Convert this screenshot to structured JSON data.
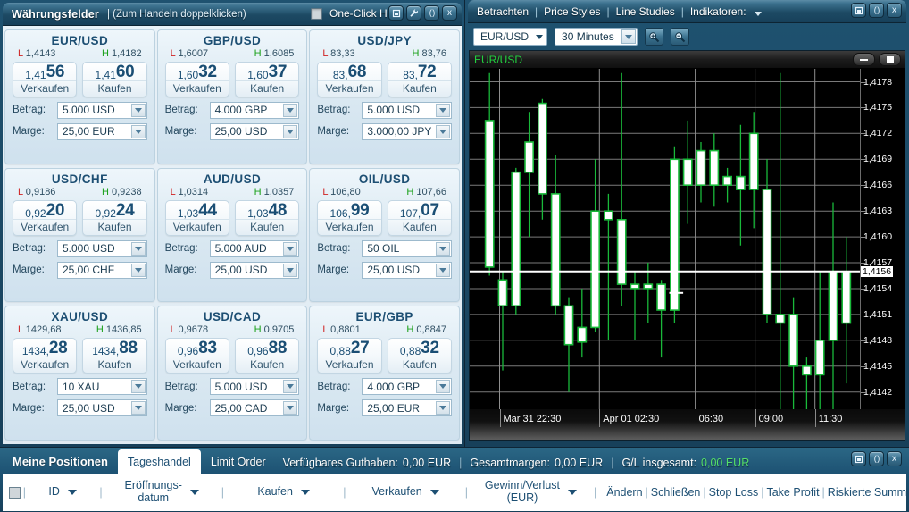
{
  "rates_panel": {
    "title": "Währungsfelder",
    "subtitle": "| (Zum Handeln doppelklicken)",
    "one_click_label": "One-Click H",
    "window_buttons": [
      "dock-icon",
      "wrench-icon",
      "detach-icon",
      "close-icon"
    ],
    "labels": {
      "amount": "Betrag:",
      "margin": "Marge:",
      "sell": "Verkaufen",
      "buy": "Kaufen",
      "low": "L",
      "high": "H"
    },
    "cells": [
      {
        "pair": "EUR/USD",
        "low": "1,4143",
        "high": "1,4182",
        "sell_small": "1,41",
        "sell_big": "56",
        "buy_small": "1,41",
        "buy_big": "60",
        "amount": "5.000 USD",
        "margin": "25,00 EUR"
      },
      {
        "pair": "GBP/USD",
        "low": "1,6007",
        "high": "1,6085",
        "sell_small": "1,60",
        "sell_big": "32",
        "buy_small": "1,60",
        "buy_big": "37",
        "amount": "4.000 GBP",
        "margin": "25,00 USD"
      },
      {
        "pair": "USD/JPY",
        "low": "83,33",
        "high": "83,76",
        "sell_small": "83,",
        "sell_big": "68",
        "buy_small": "83,",
        "buy_big": "72",
        "amount": "5.000 USD",
        "margin": "3.000,00 JPY"
      },
      {
        "pair": "USD/CHF",
        "low": "0,9186",
        "high": "0,9238",
        "sell_small": "0,92",
        "sell_big": "20",
        "buy_small": "0,92",
        "buy_big": "24",
        "amount": "5.000 USD",
        "margin": "25,00 CHF"
      },
      {
        "pair": "AUD/USD",
        "low": "1,0314",
        "high": "1,0357",
        "sell_small": "1,03",
        "sell_big": "44",
        "buy_small": "1,03",
        "buy_big": "48",
        "amount": "5.000 AUD",
        "margin": "25,00 USD"
      },
      {
        "pair": "OIL/USD",
        "low": "106,80",
        "high": "107,66",
        "sell_small": "106,",
        "sell_big": "99",
        "buy_small": "107,",
        "buy_big": "07",
        "amount": "50 OIL",
        "margin": "25,00 USD"
      },
      {
        "pair": "XAU/USD",
        "low": "1429,68",
        "high": "1436,85",
        "sell_small": "1434,",
        "sell_big": "28",
        "buy_small": "1434,",
        "buy_big": "88",
        "amount": "10 XAU",
        "margin": "25,00 USD"
      },
      {
        "pair": "USD/CAD",
        "low": "0,9678",
        "high": "0,9705",
        "sell_small": "0,96",
        "sell_big": "83",
        "buy_small": "0,96",
        "buy_big": "88",
        "amount": "5.000 USD",
        "margin": "25,00 CAD"
      },
      {
        "pair": "EUR/GBP",
        "low": "0,8801",
        "high": "0,8847",
        "sell_small": "0,88",
        "sell_big": "27",
        "buy_small": "0,88",
        "buy_big": "32",
        "amount": "4.000 GBP",
        "margin": "25,00 EUR"
      }
    ]
  },
  "chart_panel": {
    "menu": [
      "Betrachten",
      "Price Styles",
      "Line Studies",
      "Indikatoren:"
    ],
    "symbol_select": "EUR/USD",
    "interval_select": "30 Minutes",
    "zoom_in_icon": "zoom-in-icon",
    "zoom_out_icon": "zoom-out-icon",
    "chart_symbol": "EUR/USD",
    "window_buttons": [
      "dock-icon",
      "detach-icon",
      "close-icon"
    ],
    "chart_window_buttons": [
      "minimize-icon",
      "maximize-icon"
    ],
    "current_price": "1,4156"
  },
  "chart_data": {
    "type": "candlestick",
    "title": "EUR/USD",
    "interval": "30 Minutes",
    "xlabel": "",
    "ylabel": "",
    "ylim": [
      1.414,
      1.41795
    ],
    "yticks": [
      "1,4178",
      "1,4175",
      "1,4172",
      "1,4169",
      "1,4166",
      "1,4163",
      "1,4160",
      "1,4157",
      "1,4154",
      "1,4151",
      "1,4148",
      "1,4145",
      "1,4142"
    ],
    "ytick_values": [
      1.4178,
      1.4175,
      1.4172,
      1.4169,
      1.4166,
      1.4163,
      1.416,
      1.4157,
      1.4154,
      1.4151,
      1.4148,
      1.4145,
      1.4142
    ],
    "current_price_line": 1.4156,
    "xticks": [
      "Mar 31 22:30",
      "Apr 01 02:30",
      "06:30",
      "09:00",
      "11:30"
    ],
    "xtick_positions": [
      0.075,
      0.325,
      0.565,
      0.715,
      0.865
    ],
    "grid": true,
    "candles": [
      {
        "o": 1.41735,
        "h": 1.4179,
        "l": 1.41555,
        "c": 1.41565
      },
      {
        "o": 1.4155,
        "h": 1.4156,
        "l": 1.41445,
        "c": 1.4152
      },
      {
        "o": 1.4152,
        "h": 1.4168,
        "l": 1.4151,
        "c": 1.41675
      },
      {
        "o": 1.41675,
        "h": 1.41745,
        "l": 1.416,
        "c": 1.4171
      },
      {
        "o": 1.41755,
        "h": 1.4176,
        "l": 1.4162,
        "c": 1.4165
      },
      {
        "o": 1.4165,
        "h": 1.41695,
        "l": 1.4151,
        "c": 1.4152
      },
      {
        "o": 1.4152,
        "h": 1.4153,
        "l": 1.4142,
        "c": 1.41475
      },
      {
        "o": 1.41478,
        "h": 1.4154,
        "l": 1.4146,
        "c": 1.41495
      },
      {
        "o": 1.41495,
        "h": 1.4169,
        "l": 1.4149,
        "c": 1.4163
      },
      {
        "o": 1.4163,
        "h": 1.4165,
        "l": 1.4148,
        "c": 1.4162
      },
      {
        "o": 1.4162,
        "h": 1.4179,
        "l": 1.4152,
        "c": 1.41545
      },
      {
        "o": 1.41545,
        "h": 1.4156,
        "l": 1.4148,
        "c": 1.4154
      },
      {
        "o": 1.4154,
        "h": 1.4157,
        "l": 1.415,
        "c": 1.41545
      },
      {
        "o": 1.41545,
        "h": 1.4155,
        "l": 1.4146,
        "c": 1.41515
      },
      {
        "o": 1.41515,
        "h": 1.41705,
        "l": 1.415,
        "c": 1.4169
      },
      {
        "o": 1.4169,
        "h": 1.41735,
        "l": 1.41615,
        "c": 1.4166
      },
      {
        "o": 1.4166,
        "h": 1.4171,
        "l": 1.4164,
        "c": 1.417
      },
      {
        "o": 1.417,
        "h": 1.4172,
        "l": 1.41635,
        "c": 1.4166
      },
      {
        "o": 1.4166,
        "h": 1.4168,
        "l": 1.4164,
        "c": 1.4167
      },
      {
        "o": 1.4167,
        "h": 1.4173,
        "l": 1.4159,
        "c": 1.41655
      },
      {
        "o": 1.4172,
        "h": 1.41745,
        "l": 1.4161,
        "c": 1.41655
      },
      {
        "o": 1.41655,
        "h": 1.4169,
        "l": 1.415,
        "c": 1.4151
      },
      {
        "o": 1.4151,
        "h": 1.4179,
        "l": 1.414,
        "c": 1.415
      },
      {
        "o": 1.4151,
        "h": 1.4153,
        "l": 1.4138,
        "c": 1.4145
      },
      {
        "o": 1.4145,
        "h": 1.4146,
        "l": 1.4139,
        "c": 1.4144
      },
      {
        "o": 1.4144,
        "h": 1.4156,
        "l": 1.4138,
        "c": 1.4148
      },
      {
        "o": 1.4148,
        "h": 1.4164,
        "l": 1.4137,
        "c": 1.4156
      },
      {
        "o": 1.4156,
        "h": 1.416,
        "l": 1.4143,
        "c": 1.415
      }
    ]
  },
  "bottom_panel": {
    "tabs": [
      {
        "label": "Meine Positionen",
        "active": false,
        "bold": true
      },
      {
        "label": "Tageshandel",
        "active": true,
        "bold": false
      },
      {
        "label": "Limit Order",
        "active": false,
        "bold": false
      }
    ],
    "status": {
      "balance_label": "Verfügbares Guthaben:",
      "balance_value": "0,00 EUR",
      "margin_label": "Gesamtmargen:",
      "margin_value": "0,00 EUR",
      "pl_label": "G/L insgesamt:",
      "pl_value": "0,00 EUR"
    },
    "window_buttons": [
      "dock-icon",
      "detach-icon",
      "close-icon"
    ],
    "columns": [
      {
        "label": "ID",
        "caret": "solid"
      },
      {
        "label": "Eröffnungs-\ndatum",
        "caret": "thin"
      },
      {
        "label": "Kaufen",
        "caret": "thin"
      },
      {
        "label": "Verkaufen",
        "caret": "thin"
      },
      {
        "label": "Gewinn/Verlust\n(EUR)",
        "caret": "thin"
      }
    ],
    "actions": [
      "Ändern",
      "Schließen",
      "Stop Loss",
      "Take Profit",
      "Riskierte Summ"
    ]
  }
}
